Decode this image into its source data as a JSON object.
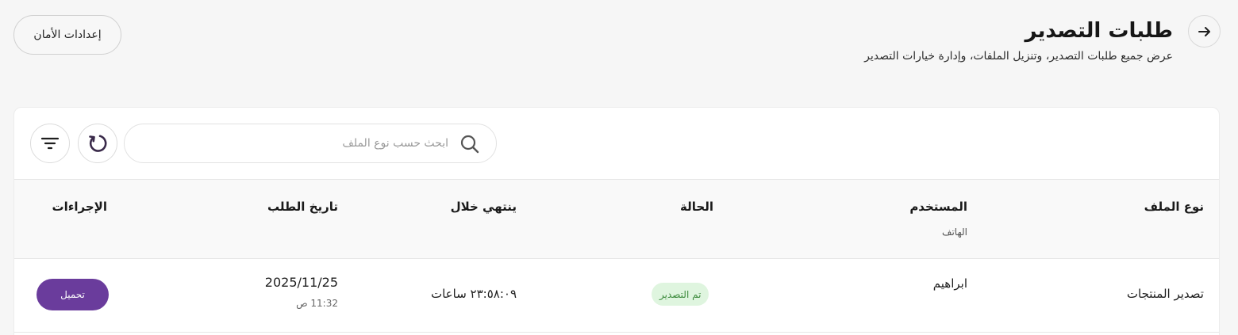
{
  "header": {
    "title": "طلبات التصدير",
    "subtitle": "عرض جميع طلبات التصدير، وتنزيل الملفات، وإدارة خيارات التصدير",
    "back_icon": "arrow-right-icon",
    "security_button": "إعدادات الأمان"
  },
  "toolbar": {
    "search_placeholder": "ابحث حسب نوع الملف",
    "search_icon": "search-icon",
    "refresh_icon": "refresh-icon",
    "filter_icon": "filter-icon"
  },
  "table": {
    "columns": {
      "file_type": "نوع الملف",
      "user": "المستخدم",
      "user_sub": "الهاتف",
      "status": "الحالة",
      "expires_in": "ينتهي خلال",
      "request_date": "تاريخ الطلب",
      "actions": "الإجراءات"
    },
    "rows": [
      {
        "file_type": "تصدير المنتجات",
        "user": "ابراهيم",
        "status": "تم التصدير",
        "expires_in": "٢٣:٥٨:٠٩ ساعات",
        "date": "2025/11/25",
        "time": "11:32 ص",
        "action": "تحميل"
      }
    ]
  },
  "colors": {
    "primary": "#6a3c9c",
    "status_bg": "#dff5df",
    "status_text": "#3c8a3c",
    "page_bg": "#f6f6f6"
  }
}
